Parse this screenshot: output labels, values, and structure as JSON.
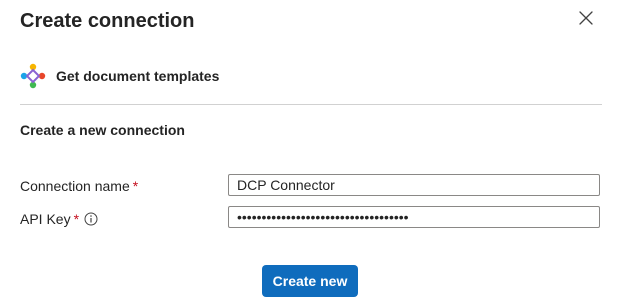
{
  "dialog": {
    "title": "Create connection",
    "close_icon": "close-icon"
  },
  "connector": {
    "icon": "connector-logo-icon",
    "name": "Get document templates"
  },
  "section": {
    "heading": "Create a new connection"
  },
  "fields": {
    "connection_name": {
      "label": "Connection name",
      "required_marker": "*",
      "value": "DCP Connector"
    },
    "api_key": {
      "label": "API Key",
      "required_marker": "*",
      "info_icon": "info-icon",
      "value": "•••••••••••••••••••••••••••••••••••"
    }
  },
  "actions": {
    "create_label": "Create new"
  },
  "colors": {
    "primary": "#0f6cbd",
    "required": "#c50f1f",
    "divider": "#d1d1d1"
  }
}
